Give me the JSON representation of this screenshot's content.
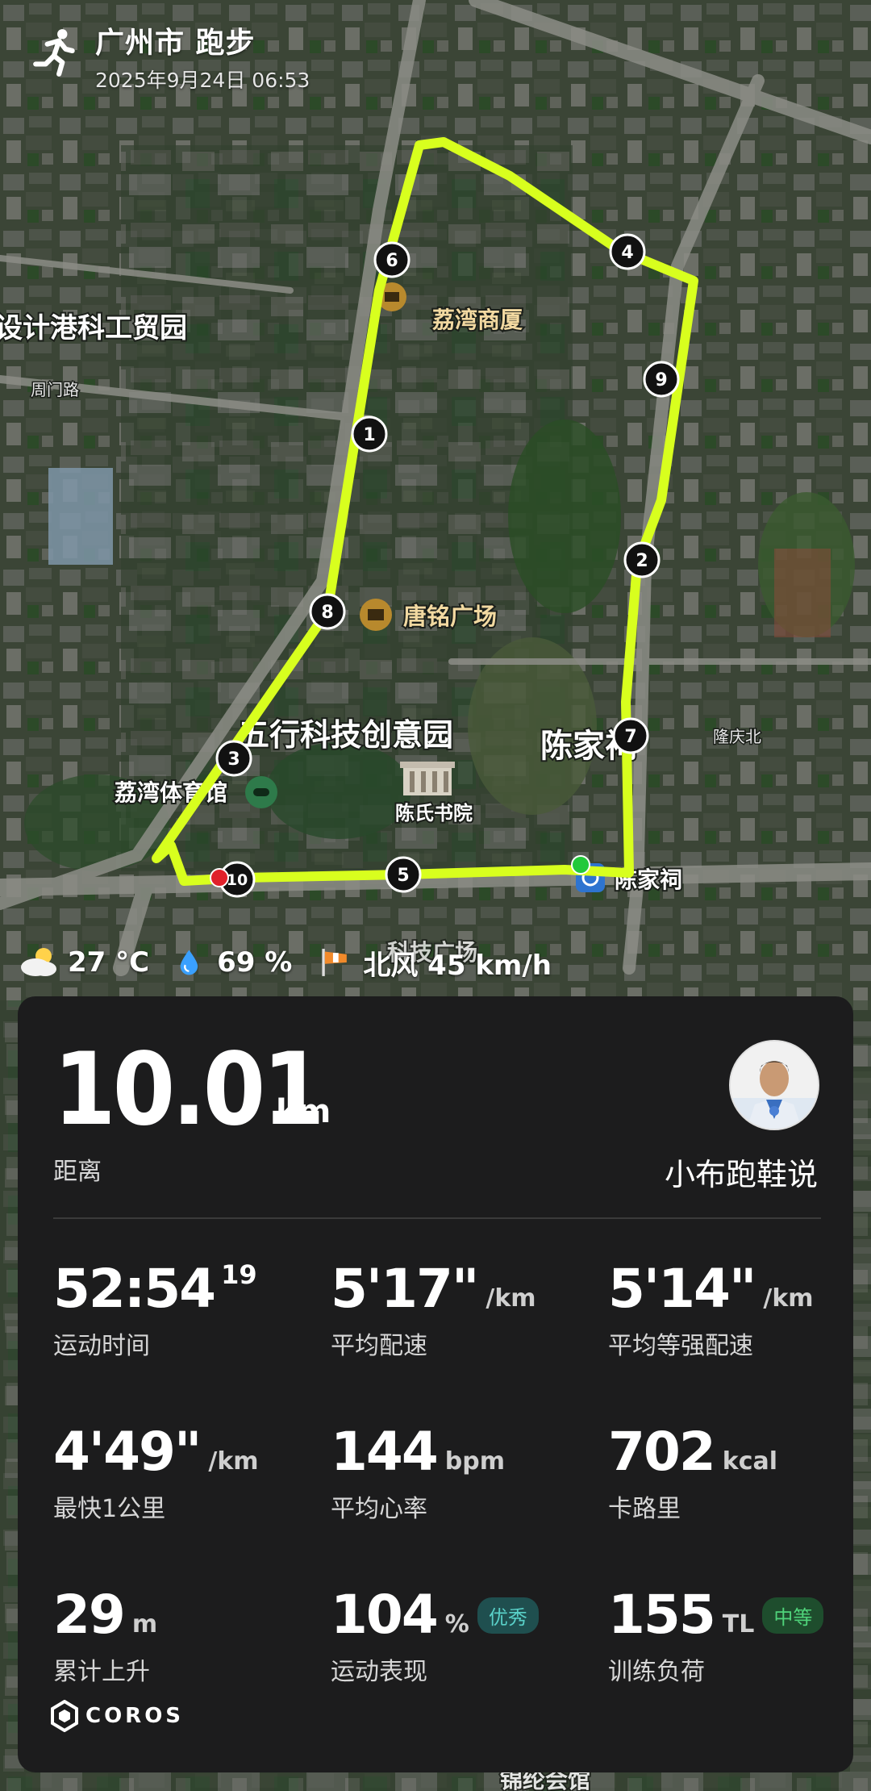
{
  "header": {
    "title": "广州市 跑步",
    "datetime": "2025年9月24日 06:53"
  },
  "map": {
    "labels": {
      "area_left": "设计港科工贸园",
      "poi_1": "荔湾商厦",
      "poi_2": "唐铭广场",
      "park": "五行科技创意园",
      "museum": "陈氏书院",
      "gym": "荔湾体育馆",
      "district": "陈家祠",
      "station": "陈家祠",
      "road_1": "周门路",
      "road_2": "隆庆北",
      "bottom_1": "科技广场",
      "bottom_2": "锦纶会馆"
    },
    "km_markers": [
      "1",
      "2",
      "3",
      "4",
      "5",
      "6",
      "7",
      "8",
      "9",
      "10"
    ]
  },
  "weather": {
    "temperature": "27 °C",
    "humidity": "69 %",
    "wind": "北风 45 km/h"
  },
  "summary": {
    "distance_value": "10.01",
    "distance_unit": "km",
    "distance_label": "距离",
    "username": "小布跑鞋说"
  },
  "stats": [
    {
      "value": "52:54",
      "sup": "19",
      "unit": "",
      "label": "运动时间"
    },
    {
      "value": "5'17\"",
      "unit": "/km",
      "label": "平均配速"
    },
    {
      "value": "5'14\"",
      "unit": "/km",
      "label": "平均等强配速"
    },
    {
      "value": "4'49\"",
      "unit": "/km",
      "label": "最快1公里"
    },
    {
      "value": "144",
      "unit": "bpm",
      "label": "平均心率"
    },
    {
      "value": "702",
      "unit": "kcal",
      "label": "卡路里"
    },
    {
      "value": "29",
      "unit": "m",
      "label": "累计上升"
    },
    {
      "value": "104",
      "unit": "%",
      "badge": "优秀",
      "label": "运动表现"
    },
    {
      "value": "155",
      "unit": "TL",
      "badge": "中等",
      "label": "训练负荷"
    }
  ],
  "brand": "COROS",
  "colors": {
    "route": "#d8ff1e",
    "card_bg": "#1c1c1d",
    "badge_teal": "#59d0c8",
    "badge_green": "#4fd37a",
    "start_dot": "#22c93a",
    "end_dot": "#e0202a"
  }
}
